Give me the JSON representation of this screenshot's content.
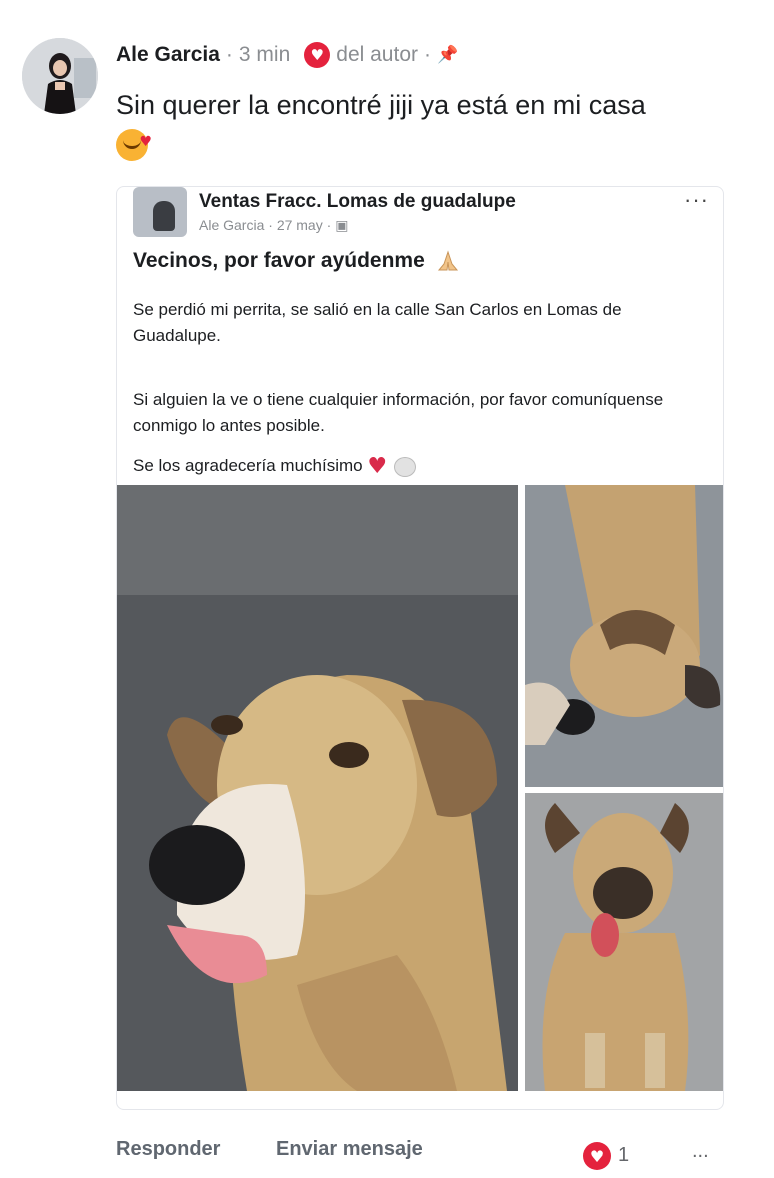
{
  "comment": {
    "author": "Ale Garcia",
    "time": "3 min",
    "reaction_label": "del autor",
    "text": "Sin querer la encontré jiji ya está en mi casa"
  },
  "shared_post": {
    "group_name": "Ventas Fracc. Lomas de guadalupe",
    "author": "Ale Garcia",
    "date": "27 may",
    "title": "Vecinos, por favor ayúdenme",
    "paragraphs": [
      "Se perdió mi perrita, se salió en la calle San Carlos en Lomas de Guadalupe.",
      "Si alguien la ve o tiene cualquier información, por favor comuníquense conmigo lo antes posible.",
      "Se los agradecería muchísimo"
    ],
    "more_label": "···"
  },
  "actions": {
    "reply": "Responder",
    "send_message": "Enviar mensaje",
    "reaction_count": "1",
    "more": "..."
  },
  "colors": {
    "reaction_red": "#e4223d",
    "meta_gray": "#8a8d91"
  }
}
